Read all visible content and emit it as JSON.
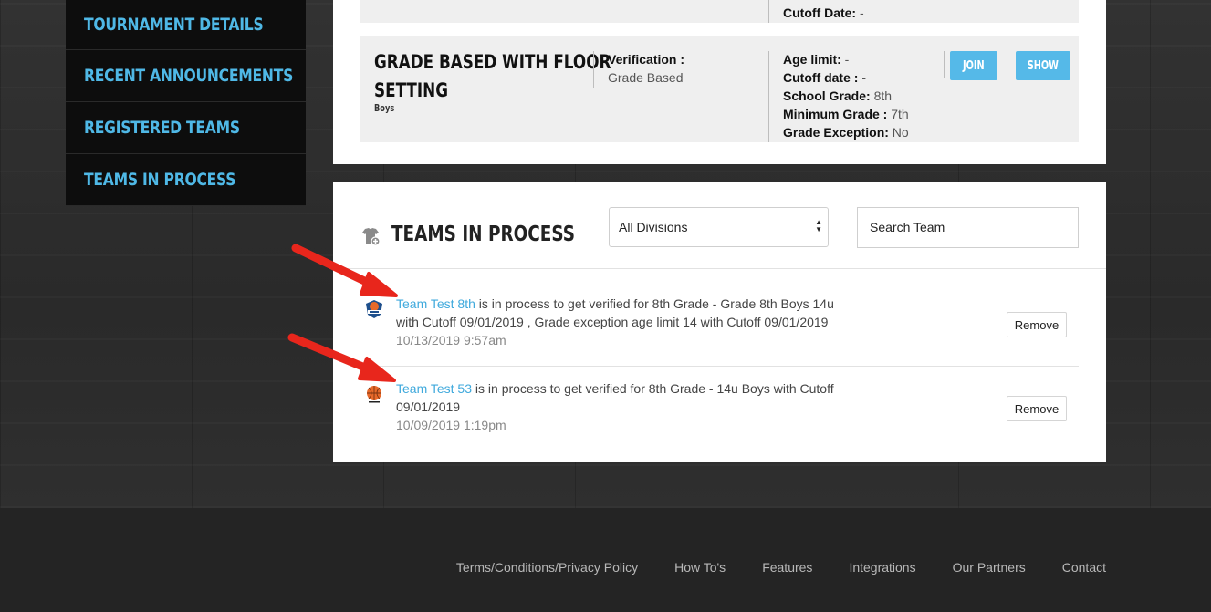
{
  "sidebar": {
    "items": [
      {
        "label": "Tournament Details"
      },
      {
        "label": "Recent Announcements"
      },
      {
        "label": "Registered Teams"
      },
      {
        "label": "Teams In Process"
      }
    ]
  },
  "prev_division": {
    "cutoff_label": "Cutoff Date:",
    "cutoff_value": " -"
  },
  "division": {
    "title_line1": "Grade Based With Floor",
    "title_line2": "Setting",
    "gender": "Boys",
    "verification_label": "Verification :",
    "verification_value": "Grade Based",
    "age_limit_label": "Age limit:",
    "age_limit_value": " -",
    "cutoff_label": "Cutoff date :",
    "cutoff_value": " -",
    "school_grade_label": "School Grade:",
    "school_grade_value": " 8th",
    "min_grade_label": "Minimum Grade :",
    "min_grade_value": " 7th",
    "grade_exception_label": "Grade Exception:",
    "grade_exception_value": " No",
    "join_label": "Join",
    "show_label": "Show"
  },
  "teams_in_process": {
    "title": "Teams In Process",
    "division_filter": "All Divisions",
    "search_placeholder": "Search Team",
    "items": [
      {
        "team_name": "Team Test 8th",
        "message_1": " is in process to get verified for 8th Grade - Grade 8th Boys 14u",
        "message_2": "with Cutoff 09/01/2019 , Grade exception age limit 14 with Cutoff 09/01/2019",
        "timestamp": "10/13/2019 9:57am",
        "remove_label": "Remove"
      },
      {
        "team_name": "Team Test 53",
        "message_1": " is in process to get verified for 8th Grade - 14u Boys with Cutoff",
        "message_2": "09/01/2019",
        "timestamp": "10/09/2019 1:19pm",
        "remove_label": "Remove"
      }
    ]
  },
  "footer": {
    "links": [
      "Terms/Conditions/Privacy Policy",
      "How To's",
      "Features",
      "Integrations",
      "Our Partners",
      "Contact"
    ]
  },
  "colors": {
    "accent": "#4fb8e6",
    "button": "#55b9e8",
    "annotation_arrow": "#e8261c"
  }
}
